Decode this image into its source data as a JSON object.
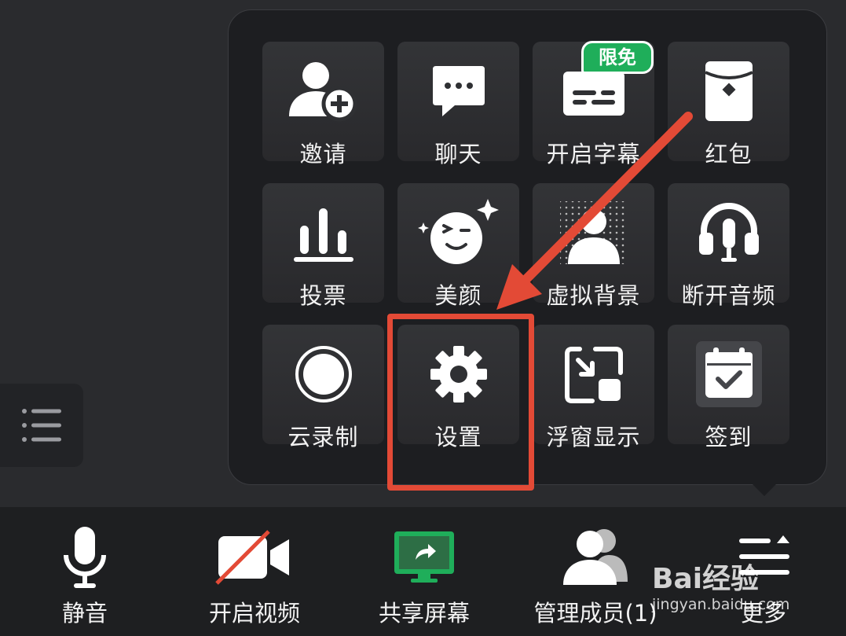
{
  "menu": {
    "badge": "限免",
    "items": [
      {
        "label": "邀请",
        "icon": "invite-user-icon"
      },
      {
        "label": "聊天",
        "icon": "chat-icon"
      },
      {
        "label": "开启字幕",
        "icon": "captions-icon"
      },
      {
        "label": "红包",
        "icon": "red-envelope-icon"
      },
      {
        "label": "投票",
        "icon": "vote-icon"
      },
      {
        "label": "美颜",
        "icon": "beauty-icon"
      },
      {
        "label": "虚拟背景",
        "icon": "virtual-background-icon"
      },
      {
        "label": "断开音频",
        "icon": "headset-icon"
      },
      {
        "label": "云录制",
        "icon": "cloud-record-icon"
      },
      {
        "label": "设置",
        "icon": "gear-icon"
      },
      {
        "label": "浮窗显示",
        "icon": "floating-window-icon"
      },
      {
        "label": "签到",
        "icon": "checkin-calendar-icon"
      }
    ]
  },
  "toolbar": {
    "items": [
      {
        "label": "静音",
        "icon": "microphone-icon"
      },
      {
        "label": "开启视频",
        "icon": "video-off-icon"
      },
      {
        "label": "共享屏幕",
        "icon": "share-screen-icon"
      },
      {
        "label": "管理成员(1)",
        "icon": "members-icon"
      },
      {
        "label": "更多",
        "icon": "more-icon"
      }
    ]
  },
  "watermark": {
    "text": "Bai经验",
    "sub": "jingyan.baidu.com"
  },
  "colors": {
    "background": "#2a2b2e",
    "panel": "#1d1e21",
    "accent_green": "#1fae5a",
    "annotation_red": "#e34a36"
  }
}
